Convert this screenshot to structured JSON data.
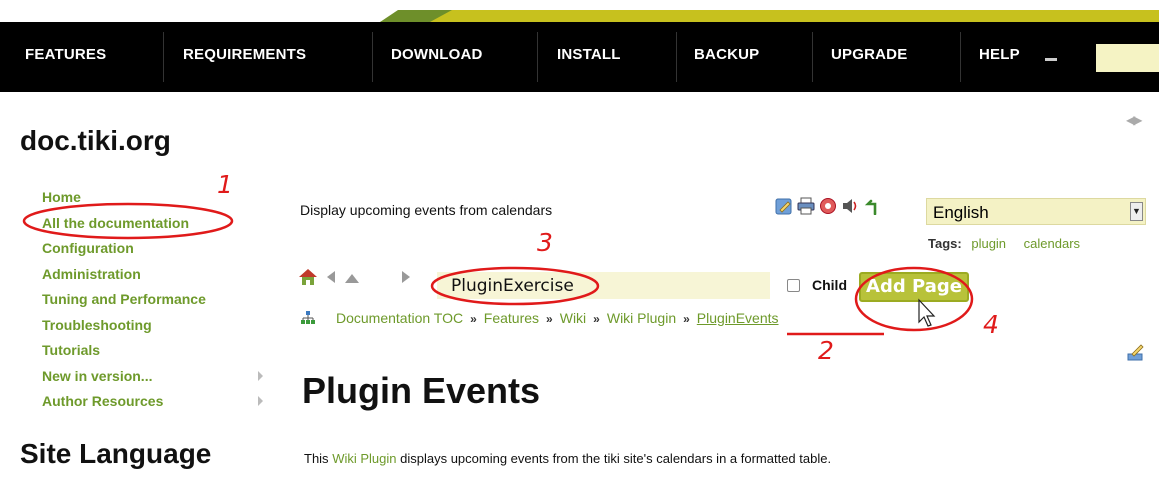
{
  "nav": {
    "items": [
      "FEATURES",
      "REQUIREMENTS",
      "DOWNLOAD",
      "INSTALL",
      "BACKUP",
      "UPGRADE",
      "HELP"
    ]
  },
  "site": {
    "title": "doc.tiki.org"
  },
  "sidebar": {
    "items": [
      {
        "label": "Home"
      },
      {
        "label": "All the documentation"
      },
      {
        "label": "Configuration"
      },
      {
        "label": "Administration"
      },
      {
        "label": "Tuning and Performance"
      },
      {
        "label": "Troubleshooting"
      },
      {
        "label": "Tutorials"
      },
      {
        "label": "New in version..."
      },
      {
        "label": "Author Resources"
      }
    ],
    "language_heading": "Site Language"
  },
  "page": {
    "description": "Display upcoming events from calendars",
    "language": "English",
    "tags_label": "Tags:",
    "tags": [
      "plugin",
      "calendars"
    ],
    "page_input_value": "PluginExercise",
    "child_label": "Child",
    "add_page_label": "Add Page",
    "breadcrumbs": [
      "Documentation TOC",
      "Features",
      "Wiki",
      "Wiki Plugin",
      "PluginEvents"
    ],
    "breadcrumb_sep": "»",
    "heading": "Plugin Events",
    "intro_prefix": "This",
    "intro_link": "Wiki Plugin",
    "intro_suffix": "displays upcoming events from the tiki site's calendars in a formatted table."
  },
  "annotations": [
    "1",
    "2",
    "3",
    "4"
  ],
  "colors": {
    "accent_green": "#6e9a2b",
    "annotation_red": "#e01a1a",
    "navbar": "#000000",
    "input_bg": "#f7f5d6"
  },
  "icons": [
    "home-icon",
    "back-icon",
    "up-icon",
    "forward-icon",
    "edit-page-icon",
    "print-icon",
    "pdf-icon",
    "audio-icon",
    "undo-icon",
    "structure-icon",
    "pencil-icon",
    "mouse-cursor-icon"
  ]
}
